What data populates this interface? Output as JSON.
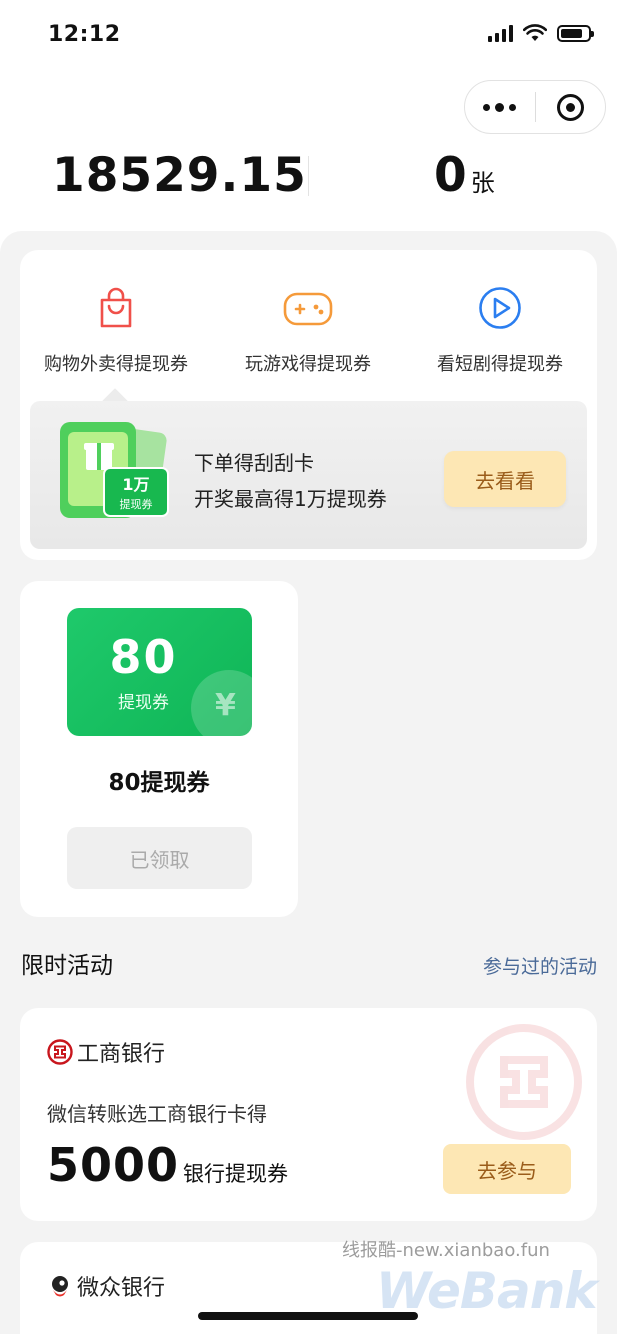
{
  "status_bar": {
    "time": "12:12"
  },
  "summary": {
    "balance": "18529.15",
    "coupon_count": "0",
    "coupon_unit": "张"
  },
  "tabs": [
    {
      "label": "购物外卖得提现券",
      "icon": "shopping-bag-icon",
      "color": "#f0504a"
    },
    {
      "label": "玩游戏得提现券",
      "icon": "gamepad-icon",
      "color": "#f59a3a"
    },
    {
      "label": "看短剧得提现券",
      "icon": "play-circle-icon",
      "color": "#2b7ef0"
    }
  ],
  "promo": {
    "art_badge_num": "1万",
    "art_badge_text": "提现券",
    "title": "下单得刮刮卡",
    "subtitle": "开奖最高得1万提现券",
    "button": "去看看"
  },
  "voucher": {
    "amount": "80",
    "sub_label": "提现券",
    "yen": "¥",
    "name": "80提现券",
    "button": "已领取"
  },
  "section": {
    "title": "限时活动",
    "link": "参与过的活动"
  },
  "activities": [
    {
      "bank": "工商银行",
      "description": "微信转账选工商银行卡得",
      "amount": "5000",
      "unit": "银行提现券",
      "button": "去参与"
    },
    {
      "bank": "微众银行"
    }
  ],
  "watermarks": {
    "site": "线报酷-new.xianbao.fun",
    "brand": "WeBank"
  },
  "colors": {
    "green": "#1fc96b",
    "accent_button": "#fde7b4",
    "accent_text": "#9a5c1a",
    "link": "#4a6a98"
  }
}
